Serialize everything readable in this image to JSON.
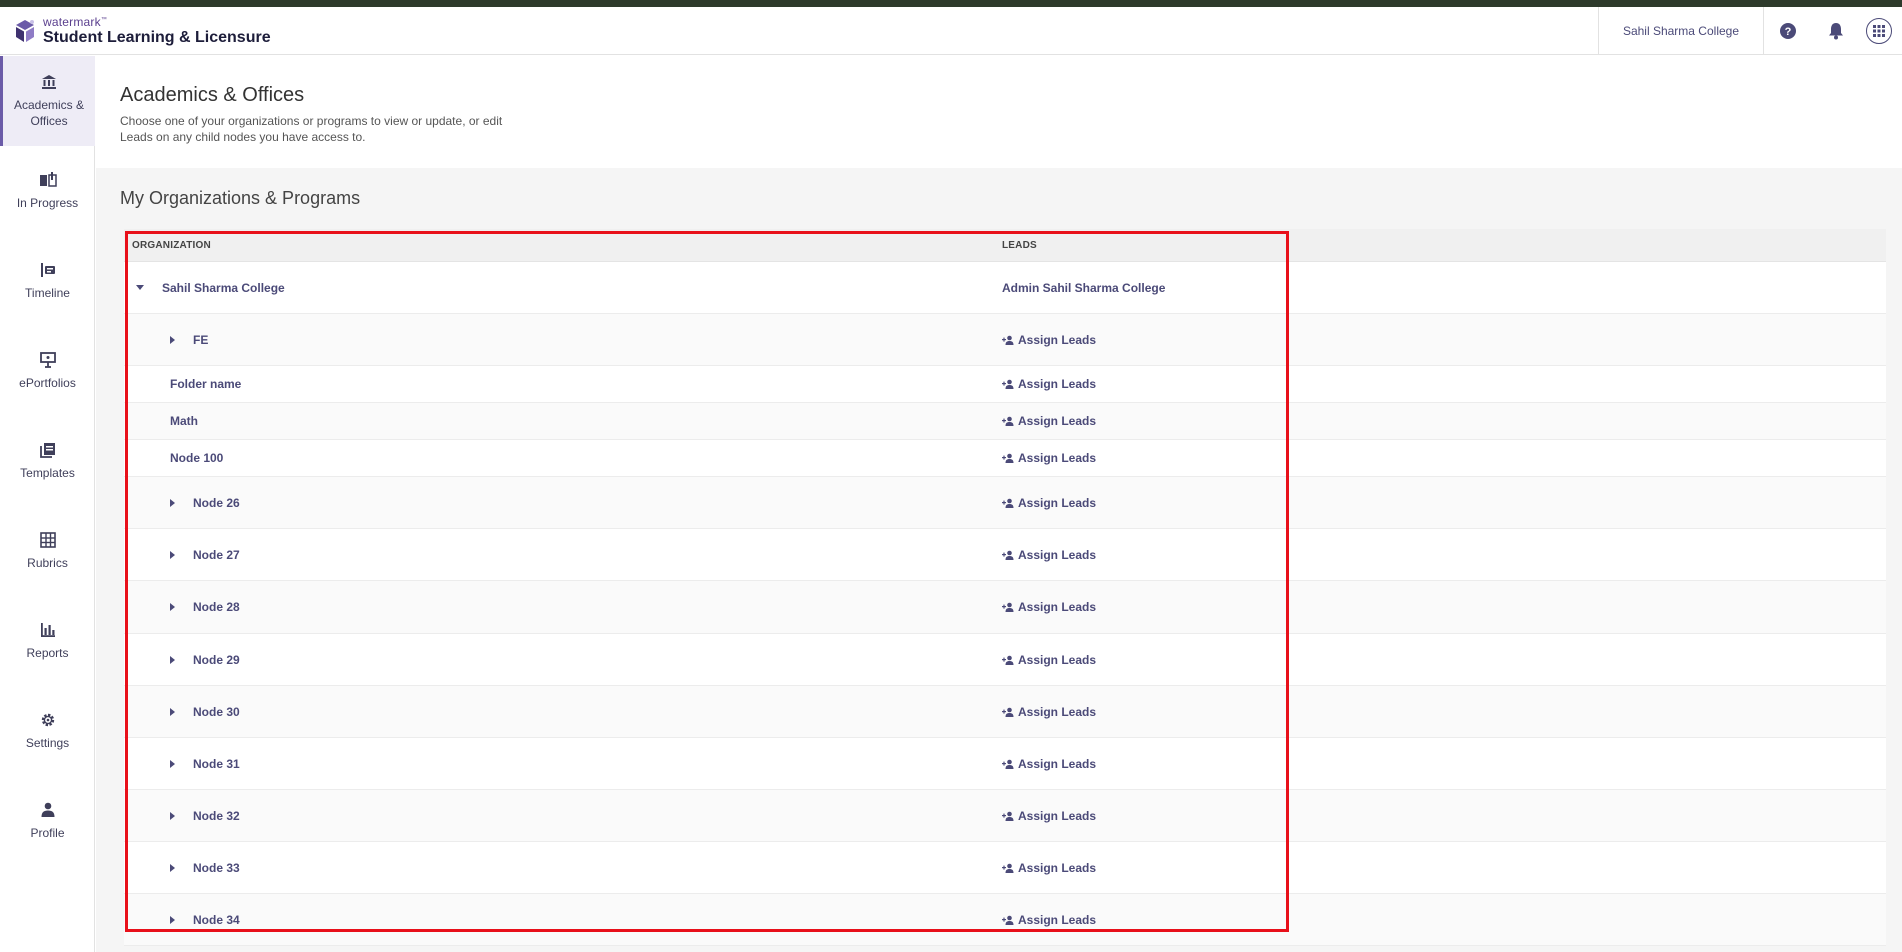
{
  "header": {
    "brand_small": "watermark",
    "brand_trademark": "™",
    "brand_title": "Student Learning & Licensure",
    "institution": "Sahil Sharma College",
    "icons": [
      "help-icon",
      "bell-icon",
      "apps-grid-icon"
    ]
  },
  "sidebar": {
    "items": [
      {
        "label": "Academics & Offices",
        "icon": "institution-icon",
        "active": true
      },
      {
        "label": "In Progress",
        "icon": "book-icon"
      },
      {
        "label": "Timeline",
        "icon": "timeline-icon"
      },
      {
        "label": "ePortfolios",
        "icon": "easel-icon"
      },
      {
        "label": "Templates",
        "icon": "templates-icon"
      },
      {
        "label": "Rubrics",
        "icon": "grid-icon"
      },
      {
        "label": "Reports",
        "icon": "bar-chart-icon"
      },
      {
        "label": "Settings",
        "icon": "gear-icon"
      },
      {
        "label": "Profile",
        "icon": "person-icon"
      }
    ]
  },
  "page": {
    "title": "Academics & Offices",
    "description": "Choose one of your organizations or programs to view or update, or edit Leads on any child nodes you have access to.",
    "section_title": "My Organizations & Programs"
  },
  "table": {
    "headers": {
      "organization": "ORGANIZATION",
      "leads": "LEADS"
    },
    "rows": [
      {
        "name": "Sahil Sharma College",
        "lead": "Admin Sahil Sharma College",
        "caret": "down",
        "level": 0
      },
      {
        "name": "FE",
        "lead": "Assign Leads",
        "caret": "right",
        "level": 1
      },
      {
        "name": "Folder name",
        "lead": "Assign Leads",
        "caret": "none",
        "level": 1
      },
      {
        "name": "Math",
        "lead": "Assign Leads",
        "caret": "none",
        "level": 1
      },
      {
        "name": "Node 100",
        "lead": "Assign Leads",
        "caret": "none",
        "level": 1
      },
      {
        "name": "Node 26",
        "lead": "Assign Leads",
        "caret": "right",
        "level": 1
      },
      {
        "name": "Node 27",
        "lead": "Assign Leads",
        "caret": "right",
        "level": 1
      },
      {
        "name": "Node 28",
        "lead": "Assign Leads",
        "caret": "right",
        "level": 1
      },
      {
        "name": "Node 29",
        "lead": "Assign Leads",
        "caret": "right",
        "level": 1
      },
      {
        "name": "Node 30",
        "lead": "Assign Leads",
        "caret": "right",
        "level": 1
      },
      {
        "name": "Node 31",
        "lead": "Assign Leads",
        "caret": "right",
        "level": 1
      },
      {
        "name": "Node 32",
        "lead": "Assign Leads",
        "caret": "right",
        "level": 1
      },
      {
        "name": "Node 33",
        "lead": "Assign Leads",
        "caret": "right",
        "level": 1
      },
      {
        "name": "Node 34",
        "lead": "Assign Leads",
        "caret": "right",
        "level": 1
      }
    ]
  },
  "colors": {
    "accent": "#4b4a78",
    "highlight": "#e8101a",
    "active_nav": "#eeecf6"
  }
}
